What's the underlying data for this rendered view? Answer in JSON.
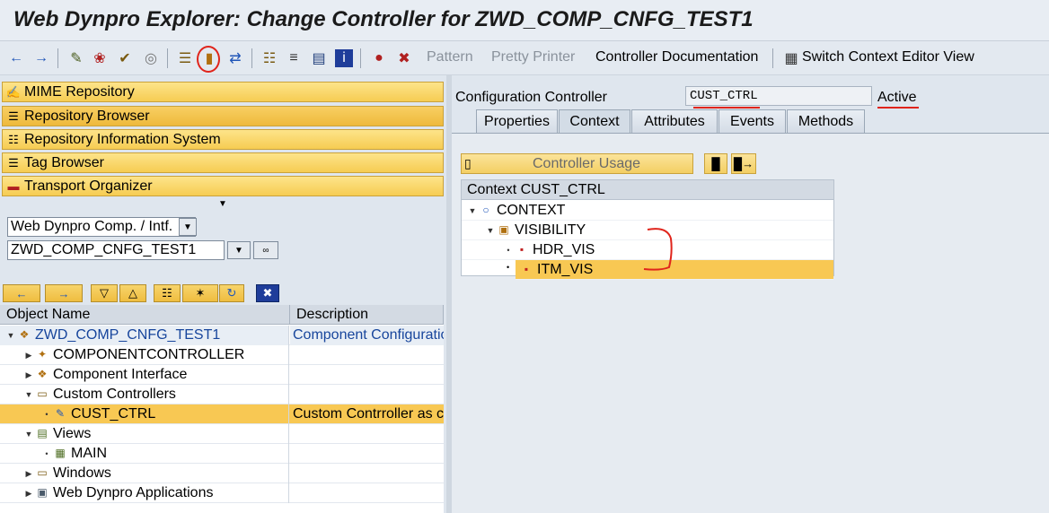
{
  "title": "Web Dynpro Explorer: Change Controller for ZWD_COMP_CNFG_TEST1",
  "toolbar": {
    "pattern": "Pattern",
    "pretty_printer": "Pretty Printer",
    "controller_documentation": "Controller Documentation",
    "switch_context": "Switch Context Editor View"
  },
  "nav": {
    "mime": "MIME Repository",
    "repo_browser": "Repository Browser",
    "repo_info": "Repository Information System",
    "tag_browser": "Tag Browser",
    "transport": "Transport Organizer"
  },
  "object_type": "Web Dynpro Comp. / Intf.",
  "object_name": "ZWD_COMP_CNFG_TEST1",
  "tree": {
    "col_object": "Object Name",
    "col_desc": "Description",
    "rows": [
      {
        "name": "ZWD_COMP_CNFG_TEST1",
        "desc": "Component Configuration"
      },
      {
        "name": "COMPONENTCONTROLLER",
        "desc": ""
      },
      {
        "name": "Component Interface",
        "desc": ""
      },
      {
        "name": "Custom Controllers",
        "desc": ""
      },
      {
        "name": "CUST_CTRL",
        "desc": "Custom Contrroller as config"
      },
      {
        "name": "Views",
        "desc": ""
      },
      {
        "name": "MAIN",
        "desc": ""
      },
      {
        "name": "Windows",
        "desc": ""
      },
      {
        "name": "Web Dynpro Applications",
        "desc": ""
      }
    ]
  },
  "right": {
    "config_label": "Configuration Controller",
    "config_value": "CUST_CTRL",
    "status": "Active",
    "tabs": [
      "Properties",
      "Context",
      "Attributes",
      "Events",
      "Methods"
    ],
    "controller_usage": "Controller Usage",
    "context_header": "Context CUST_CTRL",
    "context_root": "CONTEXT",
    "node": "VISIBILITY",
    "attrs": [
      "HDR_VIS",
      "ITM_VIS"
    ]
  },
  "colors": {
    "selection": "#f8c853",
    "annotation": "#e0241b",
    "link": "#17459c"
  }
}
